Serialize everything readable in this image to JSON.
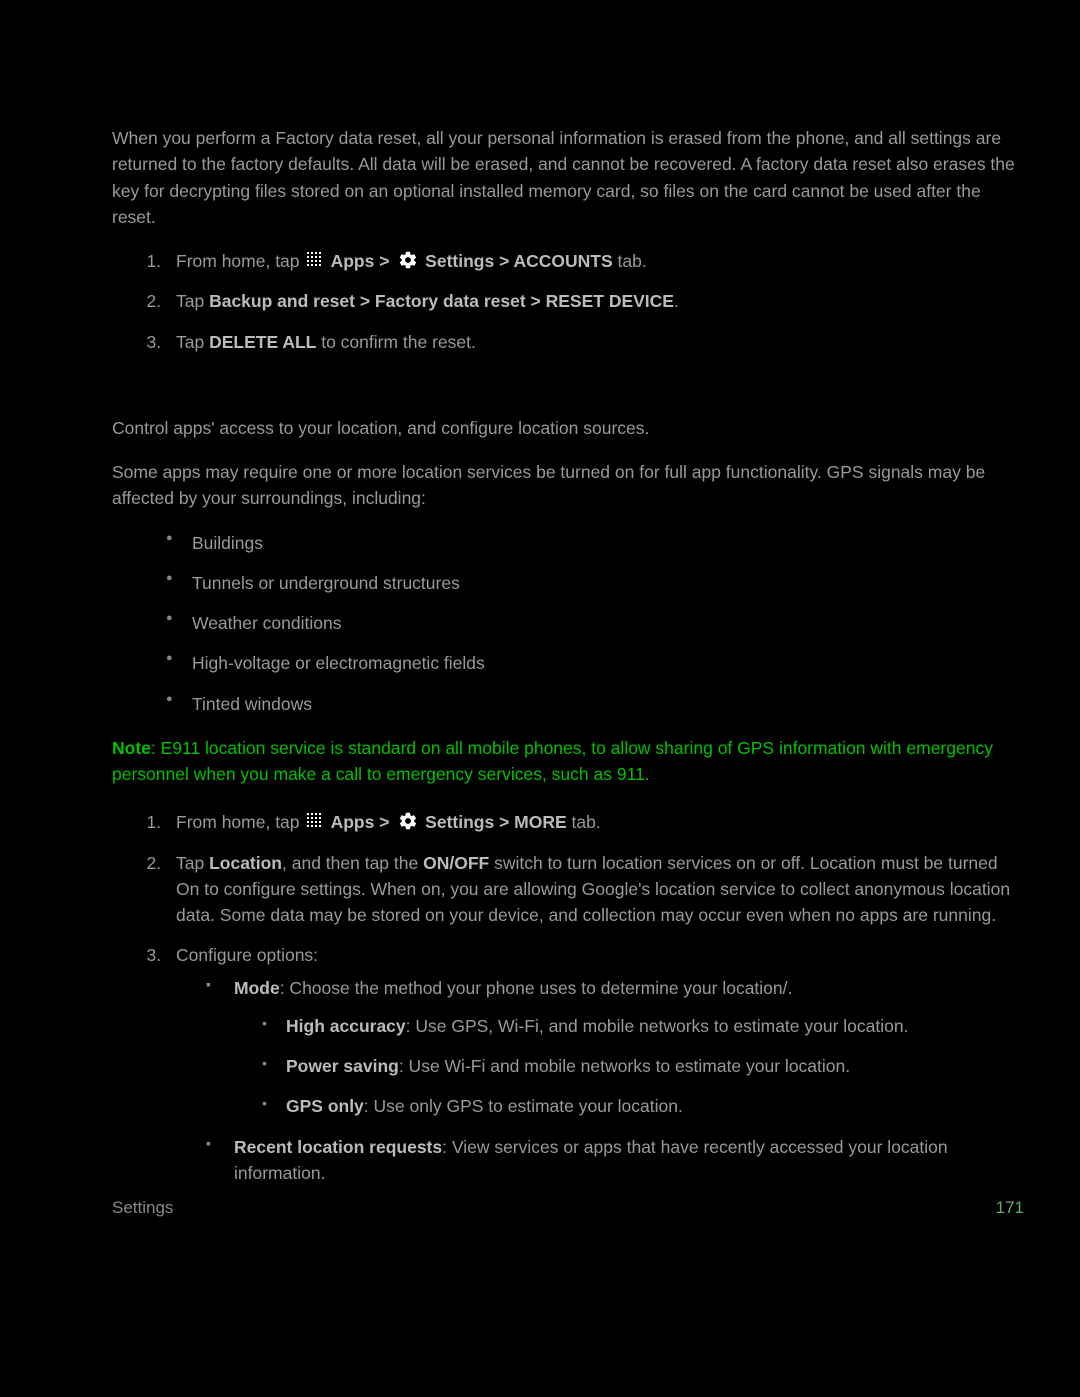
{
  "section1": {
    "intro": "When you perform a Factory data reset, all your personal information is erased from the phone, and all settings are returned to the factory defaults. All data will be erased, and cannot be recovered. A factory data reset also erases the key for decrypting files stored on an optional installed memory card, so files on the card cannot be used after the reset.",
    "steps": {
      "s1a": "From home, tap ",
      "s1b": " Apps > ",
      "s1c": " Settings > ACCOUNTS",
      "s1d": " tab.",
      "s2a": "Tap ",
      "s2b": "Backup and reset > Factory data reset > RESET DEVICE",
      "s2c": ".",
      "s3a": "Tap ",
      "s3b": "DELETE ALL",
      "s3c": " to confirm the reset."
    }
  },
  "section2": {
    "p1": "Control apps' access to your location, and configure location sources.",
    "p2": "Some apps may require one or more location services be turned on for full app functionality. GPS signals may be affected by your surroundings, including:",
    "bullets": [
      "Buildings",
      "Tunnels or underground structures",
      "Weather conditions",
      "High-voltage or electromagnetic fields",
      "Tinted windows"
    ],
    "note": {
      "label": "Note",
      "text": ": E911 location service is standard on all mobile phones, to allow sharing of GPS information with emergency personnel when you make a call to emergency services, such as 911."
    },
    "steps": {
      "s1a": "From home, tap ",
      "s1b": " Apps > ",
      "s1c": " Settings > MORE",
      "s1d": " tab.",
      "s2a": "Tap ",
      "s2b": "Location",
      "s2c": ", and then tap the ",
      "s2d": "ON/OFF",
      "s2e": " switch to turn location services on or off. Location must be turned On to configure settings. When on, you are allowing Google's location service to collect anonymous location data. Some data may be stored on your device, and collection may occur even when no apps are running.",
      "s3": "Configure options:",
      "mode_label": "Mode",
      "mode_text": ": Choose the method your phone uses to determine your location/.",
      "ha_label": "High accuracy",
      "ha_text": ": Use GPS, Wi-Fi, and mobile networks to estimate your location.",
      "ps_label": "Power saving",
      "ps_text": ": Use Wi-Fi and mobile networks to estimate your location.",
      "go_label": "GPS only",
      "go_text": ": Use only GPS to estimate your location.",
      "rlr_label": "Recent location requests",
      "rlr_text": ": View services or apps that have recently accessed your location information."
    }
  },
  "footer": {
    "left": "Settings",
    "right": "171"
  }
}
